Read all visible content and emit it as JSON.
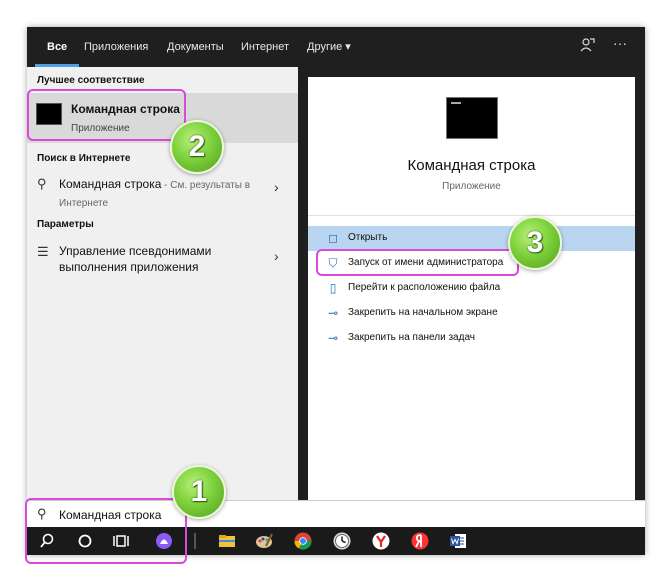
{
  "tabs": [
    {
      "label": "Все",
      "active": true
    },
    {
      "label": "Приложения"
    },
    {
      "label": "Документы"
    },
    {
      "label": "Интернет"
    },
    {
      "label": "Другие ▾"
    }
  ],
  "top_icons": [
    "feedback-icon",
    "more-icon"
  ],
  "more_glyph": "···",
  "left": {
    "best_match_heading": "Лучшее соответствие",
    "best_match": {
      "title": "Командная строка",
      "subtitle": "Приложение"
    },
    "web_heading": "Поиск в Интернете",
    "web_result": {
      "query": "Командная строка",
      "suffix": " - См. результаты в",
      "line2": "Интернете"
    },
    "settings_heading": "Параметры",
    "setting_item": {
      "line1": "Управление псевдонимами",
      "line2": "выполнения приложения"
    }
  },
  "right": {
    "title": "Командная строка",
    "subtitle": "Приложение",
    "actions": [
      {
        "label": "Открыть",
        "icon": "open-icon",
        "highlighted": true
      },
      {
        "label": "Запуск от имени администратора",
        "icon": "shield-icon"
      },
      {
        "label": "Перейти к расположению файла",
        "icon": "file-location-icon"
      },
      {
        "label": "Закрепить на начальном экране",
        "icon": "pin-icon"
      },
      {
        "label": "Закрепить на панели задач",
        "icon": "pin-icon"
      }
    ]
  },
  "search": {
    "value": "Командная строка"
  },
  "badges": [
    "1",
    "2",
    "3"
  ],
  "colors": {
    "accent": "#4f9fe8",
    "highlight": "#b9d5ef",
    "callout": "#d84ad8",
    "badge": "#7ed13c"
  }
}
